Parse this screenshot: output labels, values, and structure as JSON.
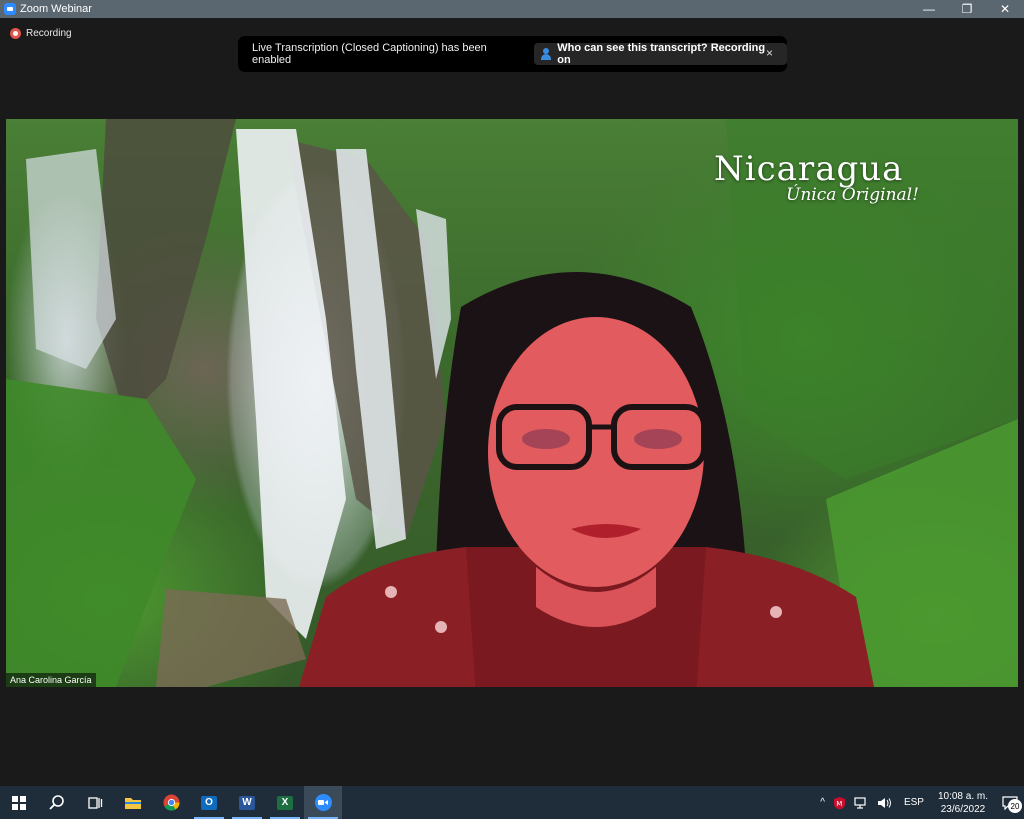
{
  "window": {
    "title": "Zoom Webinar",
    "minimize": "—",
    "restore": "❐",
    "close": "✕"
  },
  "recording": {
    "label": "Recording"
  },
  "banner": {
    "message": "Live Transcription (Closed Captioning) has been enabled",
    "link": "Who can see this transcript? Recording on",
    "close": "×"
  },
  "video": {
    "participant_name": "Ana Carolina García",
    "logo_title": "Nicaragua",
    "logo_subtitle": "Única Original!"
  },
  "taskbar": {
    "apps": [
      "start-icon",
      "search-icon",
      "task-view-icon",
      "file-explorer-icon",
      "chrome-icon",
      "outlook-icon",
      "word-icon",
      "excel-icon",
      "zoom-icon"
    ],
    "colors": {
      "outlook": "#0f6cbd",
      "word": "#2b579a",
      "excel": "#1d6f42",
      "zoom": "#2d8cff",
      "chrome_red": "#db4437",
      "explorer": "#f4c542"
    },
    "tray": {
      "chevron": "^",
      "language": "ESP",
      "time": "10:08 a. m.",
      "date": "23/6/2022",
      "notifications": "20"
    }
  }
}
